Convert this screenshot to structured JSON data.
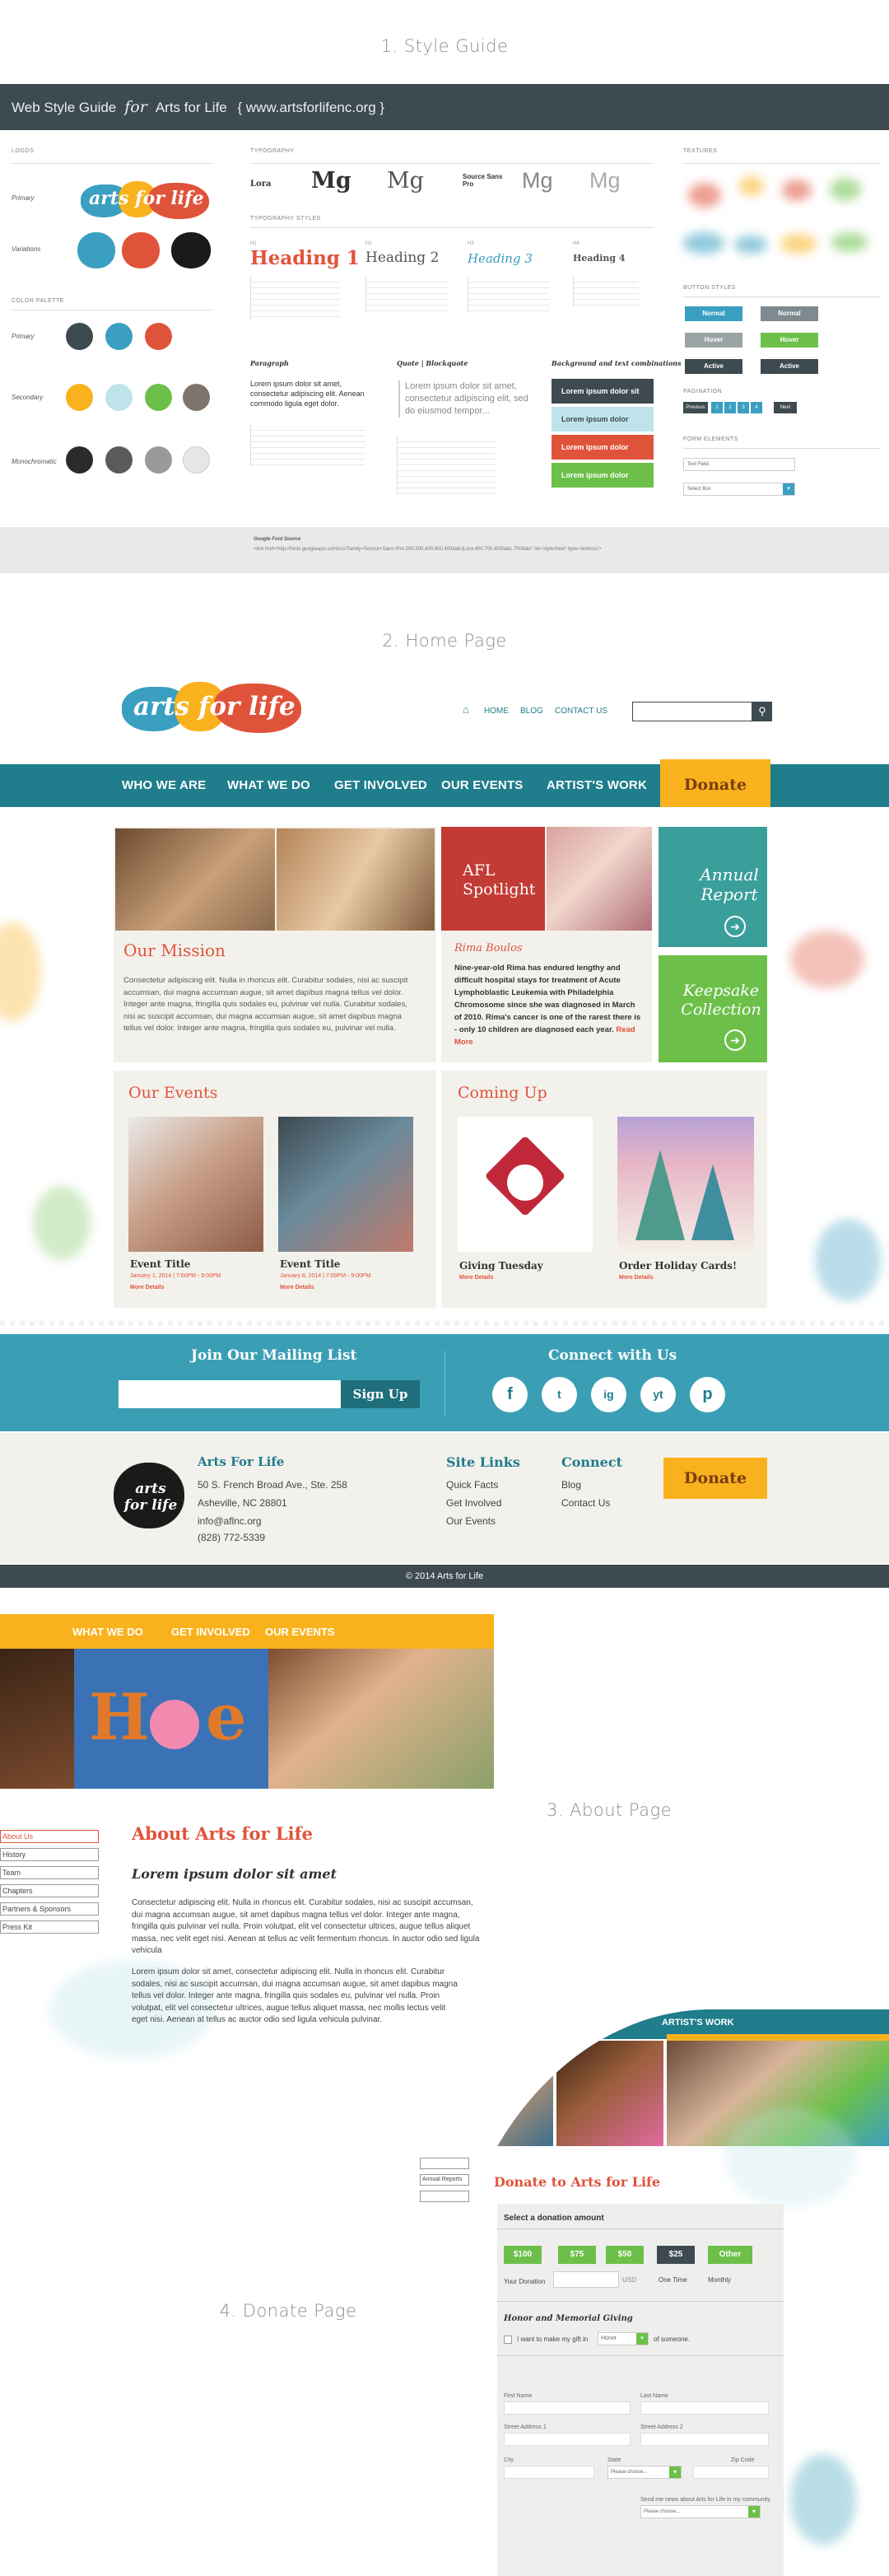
{
  "sections": {
    "style_guide": "1. Style Guide",
    "home": "2. Home Page",
    "about": "3. About Page",
    "donate": "4. Donate Page"
  },
  "style_guide": {
    "bar_title": "Web Style Guide",
    "bar_for": "for",
    "bar_site": "Arts for Life",
    "bar_url": "{ www.artsforlifenc.org }",
    "logos_heading": "LOGOS",
    "primary": "Primary",
    "variations": "Variations",
    "logo_text": "arts for life",
    "palette_heading": "COLOR PALETTE",
    "palette_primary": "Primary",
    "palette_secondary": "Secondary",
    "palette_mono": "Monochromatic",
    "typography_heading": "TYPOGRAPHY",
    "typestyles_heading": "TYPOGRAPHY STYLES",
    "font1": "Lora",
    "font2": "Source Sans Pro",
    "mg": "Mg",
    "h1": "Heading 1",
    "h2": "Heading 2",
    "h3": "Heading 3",
    "h4": "Heading 4",
    "h1_label": "H1",
    "h2_label": "H2",
    "h3_label": "H3",
    "h4_label": "H4",
    "paragraph": "Paragraph",
    "quote": "Quote | Blockquote",
    "bg_combos": "Background and text combinations",
    "para_text": "Lorem ipsum dolor sit amet, consectetur adipiscing elit. Aenean commodo ligula eget dolor.",
    "quote_text": "Lorem ipsum dolor sit amet, consectetur adipiscing elit, sed do eiusmod tempor...",
    "combo1": "Lorem ipsum dolor sit amet",
    "combo2": "Lorem ipsum dolor",
    "combo3": "Lorem ipsum dolor",
    "combo4": "Lorem ipsum dolor",
    "textures": "TEXTURES",
    "button_styles": "BUTTON STYLES",
    "pagination": "PAGINATION",
    "form_elements": "FORM ELEMENTS",
    "btn_normal": "Normal",
    "btn_hover": "Hover",
    "btn_active": "Active",
    "text_field": "Text Field",
    "select_box": "Select Box",
    "pag_prev": "Previous",
    "pag_next": "Next",
    "pag_pages": [
      "1",
      "2",
      "3",
      "4"
    ],
    "font_source_label": "Google Font Source",
    "font_source_url": "<link href='http://fonts.googleapis.com/css?family=Source+Sans+Pro:200,300,400,600,400italic|Lora:400,700,400italic,700italic' rel='stylesheet' type='text/css'>",
    "colors": {
      "primary": [
        "#3d4a50",
        "#3a9fc0",
        "#e0533b"
      ],
      "secondary": [
        "#f9b21d",
        "#bfe3ea",
        "#6cc04a",
        "#7e746b"
      ],
      "mono": [
        "#2b2b2b",
        "#5a5a5a",
        "#9a9a9a",
        "#e6e6e6"
      ]
    }
  },
  "home": {
    "logo": "arts for life",
    "nav_home": "HOME",
    "nav_blog": "BLOG",
    "nav_contact": "CONTACT US",
    "search_placeholder": "",
    "menu": [
      "WHO WE ARE",
      "WHAT WE DO",
      "GET INVOLVED",
      "OUR EVENTS",
      "ARTIST'S WORK"
    ],
    "donate": "Donate",
    "spotlight": "AFL Spotlight",
    "annual_report": "Annual Report",
    "keepsake": "Keepsake Collection",
    "mission_title": "Our Mission",
    "mission_text": "Consectetur adipiscing elit. Nulla in rhoncus elit. Curabitur sodales, nisi ac suscipit accumsan, dui magna accumsan augue, sit amet dapibus magna tellus vel dolor. Integer ante magna, fringilla quis sodales eu, pulvinar vel nulla. Curabitur sodales, nisi ac suscipit accumsan, dui magna accumsan augue, sit amet dapibus magna tellus vel dolor. Integer ante magna, fringilla quis sodales eu, pulvinar vel nulla.",
    "spot_name": "Rima Boulos",
    "spot_text": "Nine-year-old Rima has endured lengthy and difficult hospital stays for treatment of Acute Lymphoblastic Leukemia with Philadelphia Chromosome since she was diagnosed in March of 2010. Rima's cancer is one of the rarest there is - only 10 children are diagnosed each year.",
    "read_more": "Read More",
    "events_title": "Our Events",
    "coming_title": "Coming Up",
    "event1_title": "Event Title",
    "event1_date": "January 1, 2014 | 7:00PM - 9:00PM",
    "event2_title": "Event Title",
    "event2_date": "January 8, 2014 | 7:00PM - 9:00PM",
    "more_details": "More Details",
    "coming1": "Giving Tuesday",
    "coming2": "Order Holiday Cards!",
    "mailing_title": "Join Our Mailing List",
    "signup": "Sign Up",
    "connect_title": "Connect with Us",
    "social": [
      "f",
      "t",
      "ig",
      "yt",
      "p"
    ],
    "footer_org": "Arts For Life",
    "footer_addr1": "50 S. French Broad Ave., Ste. 258",
    "footer_addr2": "Asheville, NC 28801",
    "footer_email": "info@aflnc.org",
    "footer_phone": "(828) 772-5339",
    "site_links": "Site Links",
    "link1": "Quick Facts",
    "link2": "Get Involved",
    "link3": "Our Events",
    "connect": "Connect",
    "c1": "Blog",
    "c2": "Contact Us",
    "footer_donate": "Donate",
    "copyright": "© 2014 Arts for Life"
  },
  "about": {
    "nav": [
      "WHAT WE DO",
      "GET INVOLVED",
      "OUR EVENTS"
    ],
    "side": [
      "About Us",
      "History",
      "Team",
      "Chapters",
      "Partners & Sponsors",
      "Press Kit"
    ],
    "title": "About Arts for Life",
    "subtitle": "Lorem ipsum dolor sit amet",
    "p1": "Consectetur adipiscing elit. Nulla in rhoncus elit. Curabitur sodales, nisi ac suscipit accumsan, dui magna accumsan augue, sit amet dapibus magna tellus vel dolor. Integer ante magna, fringilla quis pulvinar vel nulla. Proin volutpat, elit vel consectetur ultrices, augue tellus aliquet massa, nec velit eget nisi. Aenean at tellus ac velit fermentum rhoncus. In auctor odio sed ligula vehicula",
    "p2": "Lorem ipsum dolor sit amet, consectetur adipiscing elit. Nulla in rhoncus elit. Curabitur sodales, nisi ac suscipit accumsan, dui magna accumsan augue, sit amet dapibus magna tellus vel dolor. Integer ante magna, fringilla quis sodales eu, pulvinar vel nulla. Proin volutpat, elit vel consectetur ultrices, augue tellus aliquet massa, nec mollis lectus velit eget nisi. Aenean at tellus ac auctor odio sed ligula vehicula pulvinar."
  },
  "donate": {
    "nav": "ARTIST'S WORK",
    "side_item": "Annual Reports",
    "title": "Donate to Arts for Life",
    "select_amount": "Select a donation amount",
    "amounts": [
      "$100",
      "$75",
      "$50",
      "$25",
      "Other"
    ],
    "your_donation": "Your Donation",
    "usd": "USD",
    "one_time": "One Time",
    "monthly": "Monthly",
    "honor": "Honor and Memorial Giving",
    "gift_prefix": "I want to make my gift in",
    "gift_select": "Honor",
    "gift_suffix": "of someone.",
    "first_name": "First Name",
    "last_name": "Last Name",
    "street1": "Street Address 1",
    "street2": "Street Address 2",
    "city": "City",
    "state": "State",
    "zip": "Zip Code",
    "state_select": "Please choose...",
    "newsletter": "Send me news about Arts for Life in my community.",
    "newsletter_select": "Please choose..."
  }
}
